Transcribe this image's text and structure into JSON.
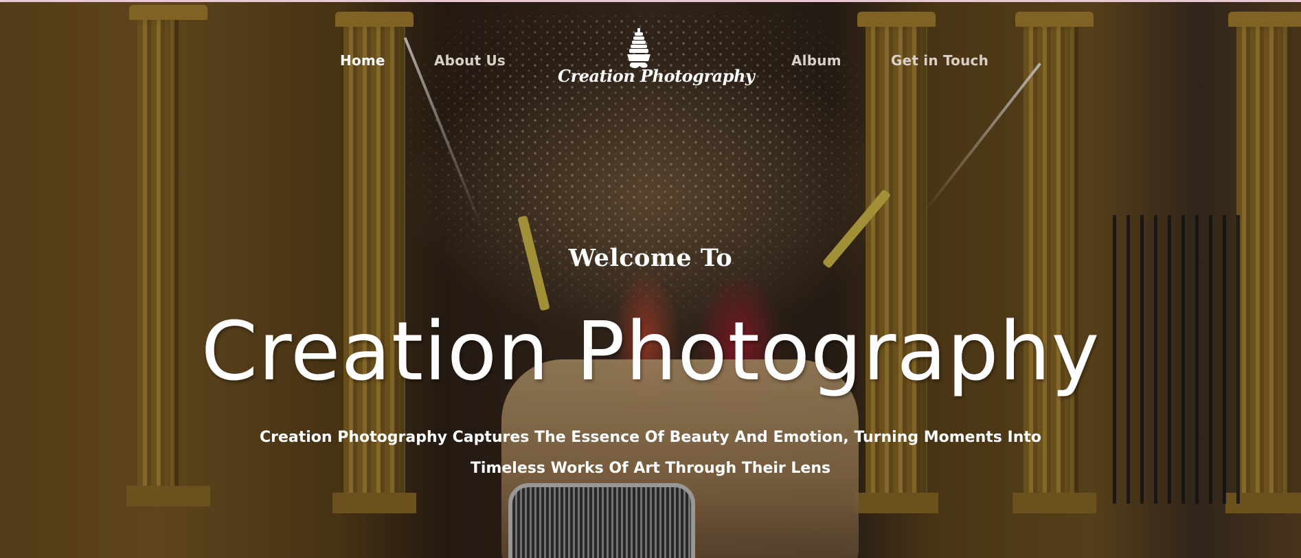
{
  "nav": {
    "items": [
      {
        "label": "Home",
        "active": true
      },
      {
        "label": "About Us",
        "active": false
      },
      {
        "label": "Album",
        "active": false
      },
      {
        "label": "Get in Touch",
        "active": false
      }
    ],
    "logo_text": "Creation Photography",
    "logo_icon": "temple-icon"
  },
  "hero": {
    "welcome": "Welcome To",
    "title": "Creation Photography",
    "tagline_line1": "Creation Photography Captures The Essence Of Beauty And Emotion, Turning Moments Into",
    "tagline_line2": "Timeless Works Of Art Through Their Lens"
  },
  "colors": {
    "text": "#ffffff",
    "nav_inactive": "#d9d0c8",
    "top_border": "#e8c9d2"
  }
}
